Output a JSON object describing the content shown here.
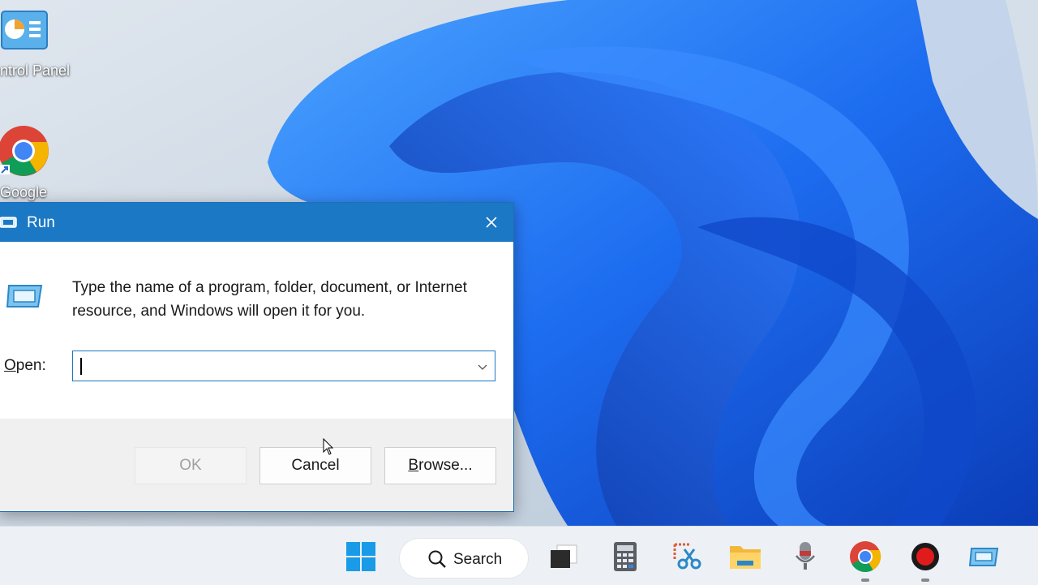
{
  "desktop": {
    "icons": [
      {
        "label": "ntrol Panel",
        "icon": "control-panel-icon"
      },
      {
        "label": "Google",
        "icon": "chrome-icon"
      }
    ]
  },
  "run_dialog": {
    "title": "Run",
    "description": "Type the name of a program, folder, document, or Internet resource, and Windows will open it for you.",
    "open_label_first": "O",
    "open_label_rest": "pen:",
    "open_value": "",
    "buttons": {
      "ok": "OK",
      "cancel": "Cancel",
      "browse_first": "B",
      "browse_rest": "rowse..."
    },
    "accent_color": "#1a78c4"
  },
  "taskbar": {
    "search_label": "Search",
    "items": [
      "start-icon",
      "search-icon",
      "task-view-icon",
      "calculator-icon",
      "snipping-tool-icon",
      "file-explorer-icon",
      "microphone-icon",
      "chrome-icon",
      "record-icon",
      "run-icon"
    ]
  }
}
